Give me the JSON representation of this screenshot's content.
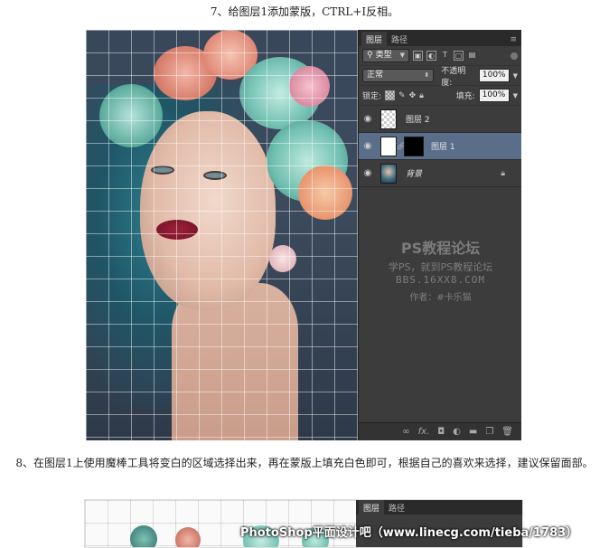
{
  "step7": {
    "text": "7、给图层1添加蒙版，CTRL+I反相。"
  },
  "panel": {
    "tabs": [
      {
        "label": "图层"
      },
      {
        "label": "路径"
      }
    ],
    "menu_icon": "≡",
    "filter": {
      "label": "类型"
    },
    "blend_mode": {
      "value": "正常"
    },
    "opacity": {
      "label": "不透明度:",
      "value": "100%"
    },
    "lock_label": "锁定:",
    "fill": {
      "label": "填充:",
      "value": "100%"
    },
    "layers": [
      {
        "name": "图层 2",
        "visible": true,
        "selected": false,
        "thumb": "transparent",
        "has_mask": false,
        "locked": false
      },
      {
        "name": "图层 1",
        "visible": true,
        "selected": true,
        "thumb": "white",
        "has_mask": true,
        "locked": false
      },
      {
        "name": "背景",
        "visible": true,
        "selected": false,
        "thumb": "photo",
        "has_mask": false,
        "locked": true
      }
    ],
    "watermark": {
      "line1": "PS教程论坛",
      "line2": "学PS，就到PS教程论坛",
      "line3": "BBS.16XX8.COM",
      "line4": "作者：#卡乐猫"
    },
    "footer_icons": [
      "link-icon",
      "fx-icon",
      "mask-icon",
      "adjustment-icon",
      "folder-icon",
      "new-layer-icon",
      "trash-icon"
    ]
  },
  "step8": {
    "text": "8、在图层1上使用魔棒工具将变白的区域选择出来，再在蒙版上填充白色即可，根据自己的喜欢来选择，建议保留面部。"
  },
  "shot2": {
    "tabs": [
      {
        "label": "图层"
      },
      {
        "label": "路径"
      }
    ]
  },
  "credit": {
    "text": "PhotoShop平面设计吧（www.linecg.com/tieba/1783）"
  },
  "colors": {
    "panel_bg": "#3c3c3c",
    "selected_layer": "#5a6e8a",
    "canvas_bg": "#38475a"
  }
}
